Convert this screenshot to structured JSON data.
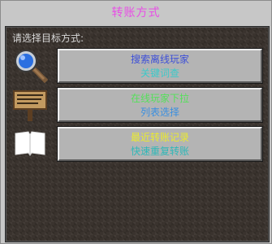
{
  "dialog": {
    "title": "转账方式",
    "prompt": "请选择目标方式:"
  },
  "options": [
    {
      "title": "搜索离线玩家",
      "subtitle": "关键词查",
      "icon": "magnifier-icon",
      "title_color": "#3d4fd8",
      "subtitle_color": "#3cc9c9"
    },
    {
      "title": "在线玩家下拉",
      "subtitle": "列表选择",
      "icon": "sign-board-icon",
      "title_color": "#54e05a",
      "subtitle_color": "#3a8fe0"
    },
    {
      "title": "最近转账记录",
      "subtitle": "快速重复转账",
      "icon": "book-icon",
      "title_color": "#eaea2e",
      "subtitle_color": "#2fb8b8"
    }
  ],
  "colors": {
    "title": "#e84ee6",
    "prompt": "#d8d8d8"
  }
}
